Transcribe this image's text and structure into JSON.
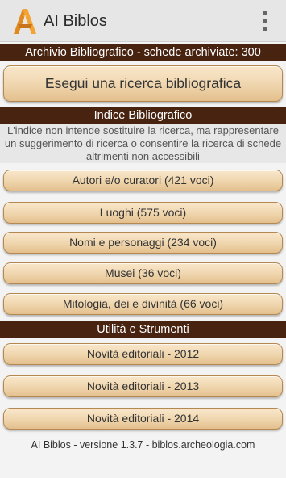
{
  "app": {
    "title": "AI Biblos",
    "icon": "ai-biblos-logo-icon",
    "menu_icon": "overflow-menu-icon"
  },
  "archive": {
    "label": "Archivio Bibliografico - schede archiviate: 300"
  },
  "search": {
    "button_label": "Esegui una ricerca bibliografica"
  },
  "index": {
    "title": "Indice Bibliografico",
    "notice": "L'indice non intende sostituire la ricerca, ma rappresentare un suggerimento di ricerca o consentire la ricerca di schede altrimenti non accessibili",
    "items": [
      {
        "label": "Autori e/o curatori (421 voci)"
      },
      {
        "label": "Luoghi (575 voci)"
      },
      {
        "label": "Nomi e personaggi (234 voci)"
      },
      {
        "label": "Musei (36 voci)"
      },
      {
        "label": "Mitologia, dei e divinità (66 voci)"
      }
    ]
  },
  "tools": {
    "title": "Utilità e Strumenti",
    "items": [
      {
        "label": "Novità editoriali - 2012"
      },
      {
        "label": "Novità editoriali - 2013"
      },
      {
        "label": "Novità editoriali - 2014"
      }
    ]
  },
  "footer": {
    "text": "AI Biblos - versione 1.3.7 - biblos.archeologia.com"
  },
  "colors": {
    "band": "#472310",
    "button_top": "#f9e7cb",
    "button_bottom": "#e3bf8d",
    "button_border": "#b48850"
  }
}
